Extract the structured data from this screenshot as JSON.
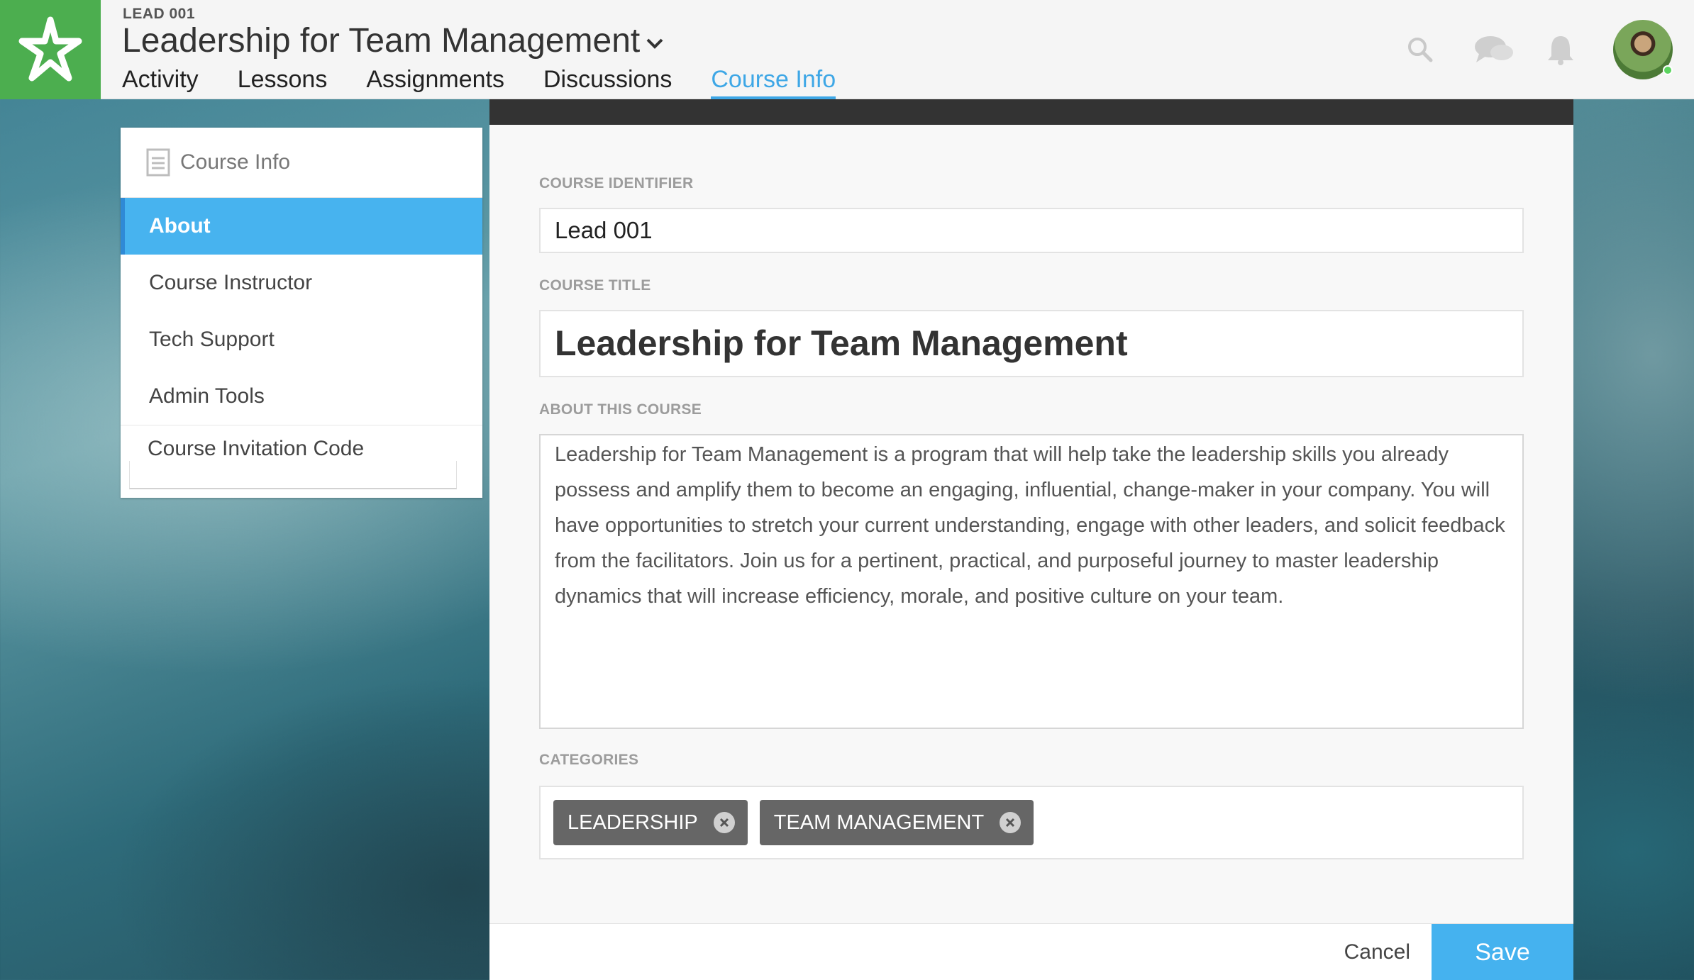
{
  "header": {
    "course_code": "LEAD 001",
    "course_title": "Leadership for Team Management",
    "nav": [
      {
        "label": "Activity",
        "active": false
      },
      {
        "label": "Lessons",
        "active": false
      },
      {
        "label": "Assignments",
        "active": false
      },
      {
        "label": "Discussions",
        "active": false
      },
      {
        "label": "Course Info",
        "active": true
      }
    ],
    "icons": [
      "search-icon",
      "chat-icon",
      "bell-icon"
    ],
    "accent_color": "#3ea7e6",
    "logo_color": "#4cae4f"
  },
  "sidebar": {
    "title": "Course Info",
    "items": [
      {
        "label": "About",
        "active": true
      },
      {
        "label": "Course Instructor",
        "active": false
      },
      {
        "label": "Tech Support",
        "active": false
      },
      {
        "label": "Admin Tools",
        "active": false
      },
      {
        "label": "Course Invitation Code",
        "active": false
      }
    ]
  },
  "form": {
    "identifier_label": "COURSE IDENTIFIER",
    "identifier_value": "Lead 001",
    "title_label": "COURSE TITLE",
    "title_value": "Leadership for Team Management",
    "about_label": "ABOUT THIS COURSE",
    "about_value": "Leadership for Team Management is a program that will help take the leadership skills you already possess and amplify them to become an engaging, influential, change-maker in your company. You will have opportunities to stretch your current understanding, engage with other leaders, and solicit feedback from the facilitators. Join us for a pertinent, practical, and purposeful journey to master leadership dynamics that will increase efficiency, morale, and positive culture on your team.",
    "categories_label": "CATEGORIES",
    "categories": [
      "LEADERSHIP",
      "TEAM MANAGEMENT"
    ]
  },
  "footer": {
    "cancel_label": "Cancel",
    "save_label": "Save"
  }
}
